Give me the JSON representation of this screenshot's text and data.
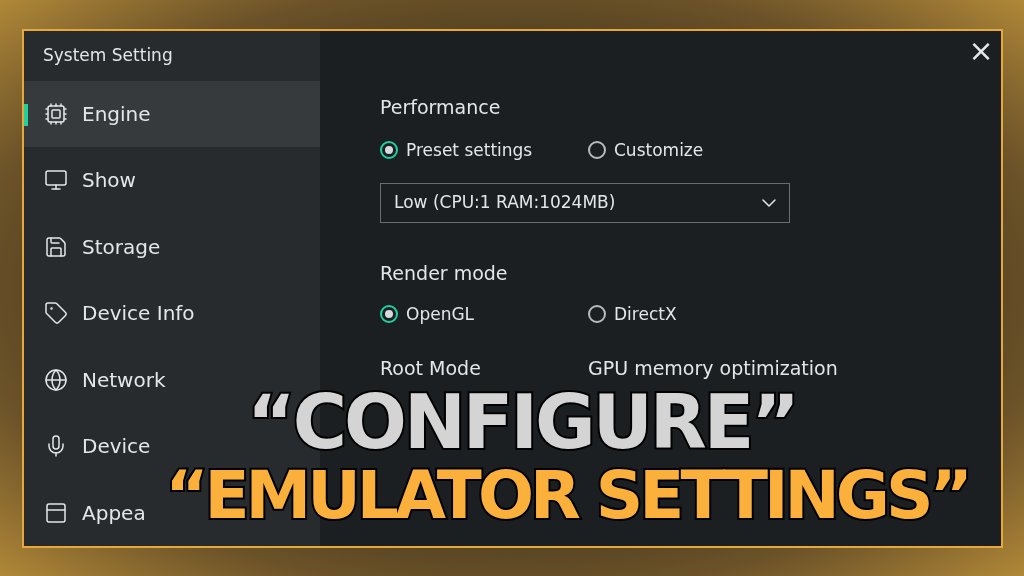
{
  "window": {
    "title": "System Setting",
    "close": "×"
  },
  "sidebar": {
    "items": [
      {
        "label": "Engine",
        "selected": true
      },
      {
        "label": "Show",
        "selected": false
      },
      {
        "label": "Storage",
        "selected": false
      },
      {
        "label": "Device Info",
        "selected": false
      },
      {
        "label": "Network",
        "selected": false
      },
      {
        "label": "Device",
        "selected": false
      },
      {
        "label": "Appea",
        "selected": false
      }
    ]
  },
  "performance": {
    "title": "Performance",
    "options": [
      {
        "label": "Preset settings",
        "selected": true
      },
      {
        "label": "Customize",
        "selected": false
      }
    ],
    "dropdown": {
      "value": "Low (CPU:1 RAM:1024MB)"
    }
  },
  "render_mode": {
    "title": "Render mode",
    "options": [
      {
        "label": "OpenGL",
        "selected": true
      },
      {
        "label": "DirectX",
        "selected": false
      }
    ]
  },
  "root_mode": {
    "title": "Root Mode"
  },
  "gpu_memory": {
    "title": "GPU memory optimization"
  },
  "overlay_title": {
    "line_1": "“CONFIGURE”",
    "line_2": "“EMULATOR SETTINGS”"
  }
}
